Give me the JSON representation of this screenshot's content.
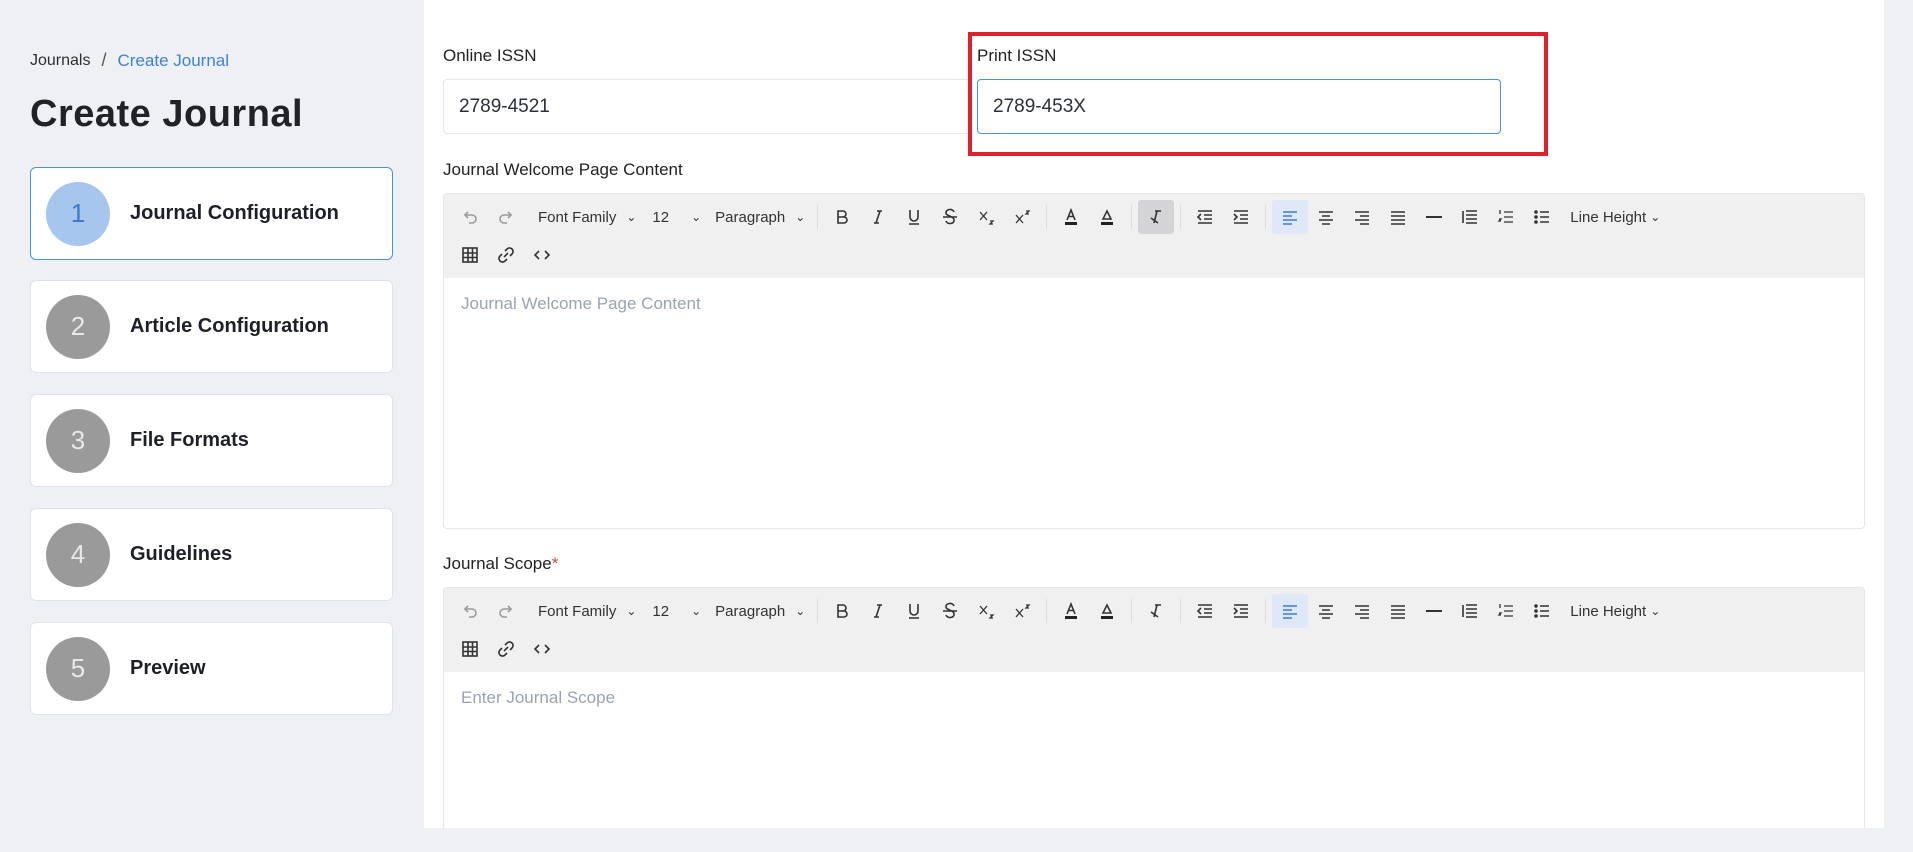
{
  "breadcrumb": {
    "root": "Journals",
    "separator": "/",
    "current": "Create Journal"
  },
  "page_title": "Create Journal",
  "steps": [
    {
      "number": "1",
      "label": "Journal Configuration",
      "active": true
    },
    {
      "number": "2",
      "label": "Article Configuration",
      "active": false
    },
    {
      "number": "3",
      "label": "File Formats",
      "active": false
    },
    {
      "number": "4",
      "label": "Guidelines",
      "active": false
    },
    {
      "number": "5",
      "label": "Preview",
      "active": false
    }
  ],
  "form": {
    "online_issn": {
      "label": "Online ISSN",
      "value": "2789-4521"
    },
    "print_issn": {
      "label": "Print ISSN",
      "value": "2789-453X"
    },
    "welcome": {
      "label": "Journal Welcome Page Content",
      "placeholder": "Journal Welcome Page Content"
    },
    "scope": {
      "label": "Journal Scope",
      "required_mark": "*",
      "placeholder": "Enter Journal Scope"
    }
  },
  "toolbar": {
    "font_family": "Font Family",
    "font_size": "12",
    "block_format": "Paragraph",
    "line_height": "Line Height"
  },
  "colors": {
    "accent": "#4a90e2",
    "highlight": "#e0202a",
    "step_inactive": "#9a9a9a",
    "step_active": "#a6c6ee"
  }
}
